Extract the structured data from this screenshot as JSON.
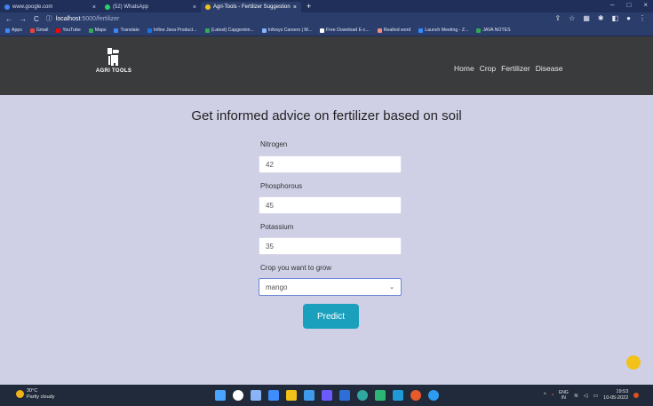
{
  "browser": {
    "tabs": [
      {
        "label": "www.google.com",
        "icon_color": "#4285f4"
      },
      {
        "label": "(52) WhatsApp",
        "icon_color": "#25d366"
      },
      {
        "label": "Agri-Tools - Fertilizer Suggestion",
        "icon_color": "#f2c21a",
        "active": true
      }
    ],
    "new_tab": "+",
    "url_host": "localhost",
    "url_path": ":5000/fertilizer",
    "bookmarks": [
      {
        "label": "Apps",
        "color": "#4285f4"
      },
      {
        "label": "Gmail",
        "color": "#ea4335"
      },
      {
        "label": "YouTube",
        "color": "#ff0000"
      },
      {
        "label": "Maps",
        "color": "#34a853"
      },
      {
        "label": "Translate",
        "color": "#4285f4"
      },
      {
        "label": "Infine Java Product...",
        "color": "#1a73e8"
      },
      {
        "label": "(Latest) Capgemini...",
        "color": "#34a853"
      },
      {
        "label": "Infosys Careers | M...",
        "color": "#8ab4f8"
      },
      {
        "label": "Free Download E-c...",
        "color": "#ffffff"
      },
      {
        "label": "Realted word",
        "color": "#f28b82"
      },
      {
        "label": "Launch Meeting - Z...",
        "color": "#2d8cff"
      },
      {
        "label": "JAVA NOTES",
        "color": "#34a853"
      }
    ]
  },
  "site": {
    "logo_text": "AGRI TOOLS",
    "nav": [
      "Home",
      "Crop",
      "Fertilizer",
      "Disease"
    ]
  },
  "form": {
    "heading": "Get informed advice on fertilizer based on soil",
    "nitrogen_label": "Nitrogen",
    "nitrogen_value": "42",
    "phosphorous_label": "Phosphorous",
    "phosphorous_value": "45",
    "potassium_label": "Potassium",
    "potassium_value": "35",
    "crop_label": "Crop you want to grow",
    "crop_value": "mango",
    "predict_label": "Predict"
  },
  "taskbar": {
    "temperature": "30°C",
    "weather": "Partly cloudy",
    "lang_top": "ENG",
    "lang_bottom": "IN",
    "time": "19:53",
    "date": "10-05-2022",
    "app_colors": [
      "#4aa3ff",
      "#ffffff",
      "#8ab4f8",
      "#3f8cff",
      "#f2c21a",
      "#3d9be9",
      "#6b5bff",
      "#2d6fd8",
      "#2fa8a0",
      "#2bb673",
      "#1f9ad6",
      "#e85a2a",
      "#2d9bf0"
    ]
  }
}
